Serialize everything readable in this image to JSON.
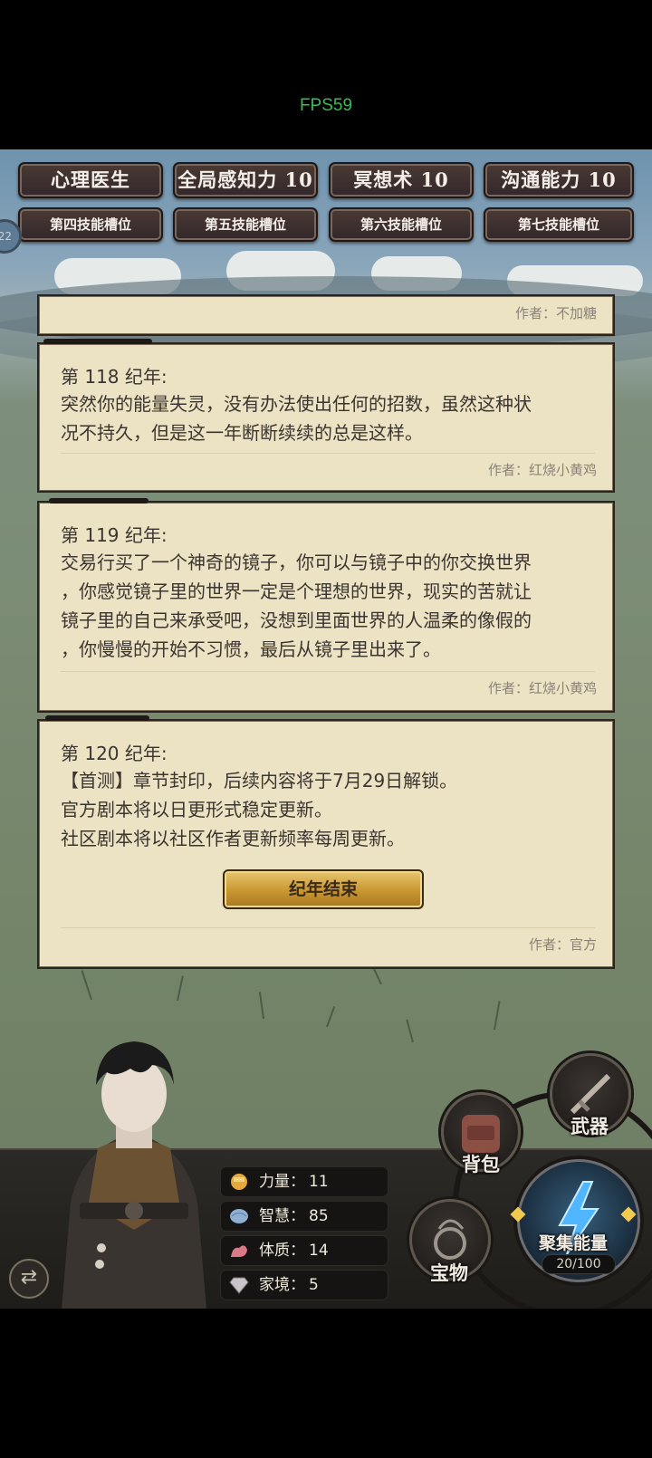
{
  "status": {
    "fps": "FPS59"
  },
  "skills": {
    "top": [
      "心理医生",
      "全局感知力 10",
      "冥想术 10",
      "沟通能力 10"
    ],
    "slots": [
      "第四技能槽位",
      "第五技能槽位",
      "第六技能槽位",
      "第七技能槽位"
    ],
    "level_badge": "22"
  },
  "cards": [
    {
      "year": "",
      "lines": [],
      "author": "作者：不加糖"
    },
    {
      "year": "第 118 纪年:",
      "lines": [
        "突然你的能量失灵，没有办法使出任何的招数，虽然这种状",
        "况不持久，但是这一年断断续续的总是这样。"
      ],
      "author": "作者：红烧小黄鸡"
    },
    {
      "year": "第 119 纪年:",
      "lines": [
        "交易行买了一个神奇的镜子，你可以与镜子中的你交换世界",
        "，你感觉镜子里的世界一定是个理想的世界，现实的苦就让",
        "镜子里的自己来承受吧，没想到里面世界的人温柔的像假的",
        "，你慢慢的开始不习惯，最后从镜子里出来了。"
      ],
      "author": "作者：红烧小黄鸡"
    },
    {
      "year": "第 120 纪年:",
      "lines": [
        "【首测】章节封印，后续内容将于7月29日解锁。",
        "官方剧本将以日更形式稳定更新。",
        "社区剧本将以社区作者更新频率每周更新。"
      ],
      "author": "作者：官方",
      "button": "纪年结束"
    }
  ],
  "stats": [
    {
      "label": "力量：",
      "value": "11",
      "icon": "fist-icon"
    },
    {
      "label": "智慧：",
      "value": "85",
      "icon": "brain-icon"
    },
    {
      "label": "体质：",
      "value": "14",
      "icon": "muscle-icon"
    },
    {
      "label": "家境：",
      "value": "5",
      "icon": "diamond-icon"
    }
  ],
  "actions": {
    "weapon": "武器",
    "backpack": "背包",
    "treasure": "宝物",
    "gather": "聚集能量",
    "gather_progress": "20/100"
  },
  "colors": {
    "fps": "#3dbb55",
    "card_bg": "#ece3c4",
    "button_gold": "#c99731"
  }
}
